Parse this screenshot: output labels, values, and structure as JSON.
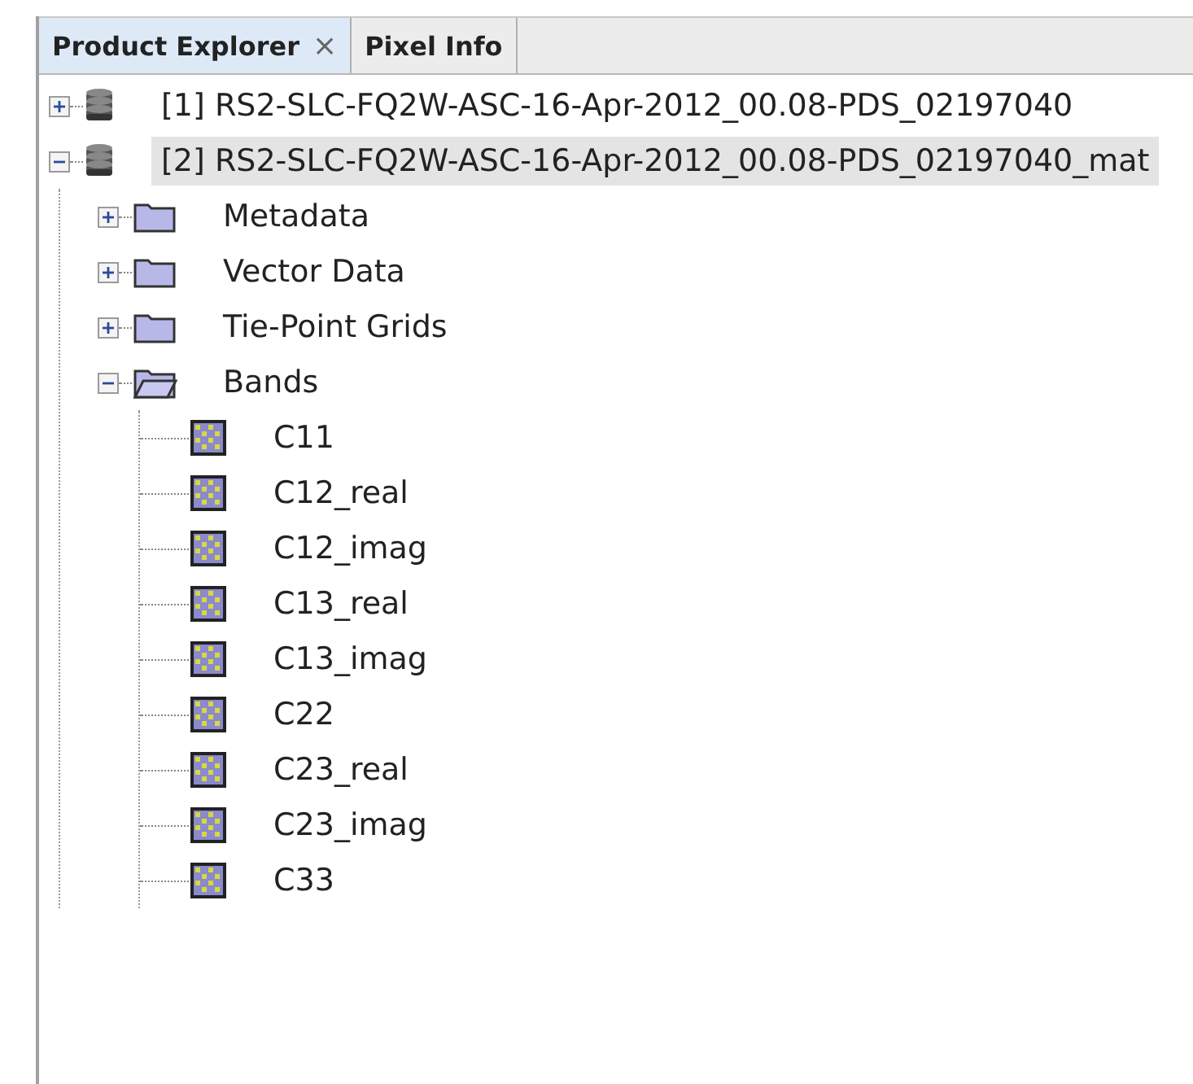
{
  "tabs": [
    {
      "label": "Product Explorer",
      "selected": true,
      "close": "×"
    },
    {
      "label": "Pixel Info",
      "selected": false
    }
  ],
  "tree": [
    {
      "label": "[1] RS2-SLC-FQ2W-ASC-16-Apr-2012_00.08-PDS_02197040",
      "kind": "product",
      "expanded": false,
      "selected": false
    },
    {
      "label": "[2] RS2-SLC-FQ2W-ASC-16-Apr-2012_00.08-PDS_02197040_mat",
      "kind": "product",
      "expanded": true,
      "selected": true,
      "children": [
        {
          "label": "Metadata",
          "kind": "folder",
          "expanded": false,
          "selected": false
        },
        {
          "label": "Vector Data",
          "kind": "folder",
          "expanded": false,
          "selected": false
        },
        {
          "label": "Tie-Point Grids",
          "kind": "folder",
          "expanded": false,
          "selected": false
        },
        {
          "label": "Bands",
          "kind": "folder",
          "expanded": true,
          "selected": false,
          "children": [
            {
              "label": "C11",
              "kind": "band",
              "selected": false
            },
            {
              "label": "C12_real",
              "kind": "band",
              "selected": false
            },
            {
              "label": "C12_imag",
              "kind": "band",
              "selected": false
            },
            {
              "label": "C13_real",
              "kind": "band",
              "selected": false
            },
            {
              "label": "C13_imag",
              "kind": "band",
              "selected": false
            },
            {
              "label": "C22",
              "kind": "band",
              "selected": false
            },
            {
              "label": "C23_real",
              "kind": "band",
              "selected": false
            },
            {
              "label": "C23_imag",
              "kind": "band",
              "selected": false
            },
            {
              "label": "C33",
              "kind": "band",
              "selected": false
            }
          ]
        }
      ]
    }
  ]
}
